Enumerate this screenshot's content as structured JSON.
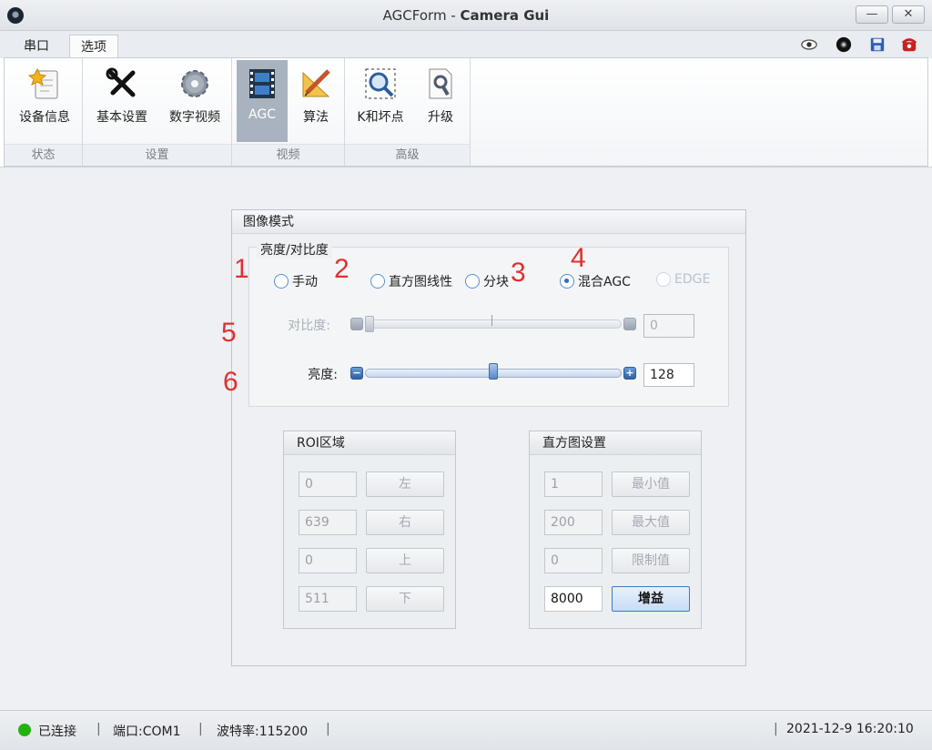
{
  "window": {
    "title_light": "AGCForm - ",
    "title_bold": "Camera Gui",
    "min_label": "—",
    "close_label": "✕"
  },
  "tabs": [
    {
      "label": "串口"
    },
    {
      "label": "选项"
    }
  ],
  "ribbon": {
    "groups": [
      {
        "label": "状态",
        "buttons": [
          {
            "label": "设备信息",
            "icon": "device-info-icon"
          }
        ]
      },
      {
        "label": "设置",
        "buttons": [
          {
            "label": "基本设置",
            "icon": "tools-icon"
          },
          {
            "label": "数字视频",
            "icon": "gear-icon"
          }
        ]
      },
      {
        "label": "视频",
        "buttons": [
          {
            "label": "AGC",
            "icon": "film-icon"
          },
          {
            "label": "算法",
            "icon": "pencil-ruler-icon"
          }
        ]
      },
      {
        "label": "高级",
        "buttons": [
          {
            "label": "K和坏点",
            "icon": "magnifier-icon"
          },
          {
            "label": "升级",
            "icon": "wrench-file-icon"
          }
        ]
      }
    ]
  },
  "panel": {
    "title": "图像模式",
    "brightness_group": "亮度/对比度",
    "radios": [
      {
        "label": "手动",
        "checked": false,
        "enabled": true
      },
      {
        "label": "直方图线性",
        "checked": false,
        "enabled": true
      },
      {
        "label": "分块",
        "checked": false,
        "enabled": true
      },
      {
        "label": "混合AGC",
        "checked": true,
        "enabled": true
      },
      {
        "label": "EDGE",
        "checked": false,
        "enabled": false
      }
    ],
    "annotations": [
      "1",
      "2",
      "3",
      "4",
      "5",
      "6"
    ],
    "contrast": {
      "label": "对比度:",
      "value": "0",
      "level": 0,
      "enabled": false
    },
    "brightness": {
      "label": "亮度:",
      "value": "128",
      "level": 0.5,
      "enabled": true
    },
    "roi": {
      "title": "ROI区域",
      "rows": [
        {
          "value": "0",
          "button": "左"
        },
        {
          "value": "639",
          "button": "右"
        },
        {
          "value": "0",
          "button": "上"
        },
        {
          "value": "511",
          "button": "下"
        }
      ]
    },
    "histogram": {
      "title": "直方图设置",
      "rows": [
        {
          "value": "1",
          "button": "最小值",
          "enabled": false
        },
        {
          "value": "200",
          "button": "最大值",
          "enabled": false
        },
        {
          "value": "0",
          "button": "限制值",
          "enabled": false
        },
        {
          "value": "8000",
          "button": "增益",
          "enabled": true
        }
      ]
    }
  },
  "status": {
    "connected": "已连接",
    "port": "端口:COM1",
    "baud": "波特率:115200",
    "datetime": "2021-12-9 16:20:10",
    "led_color": "#22b30f"
  }
}
